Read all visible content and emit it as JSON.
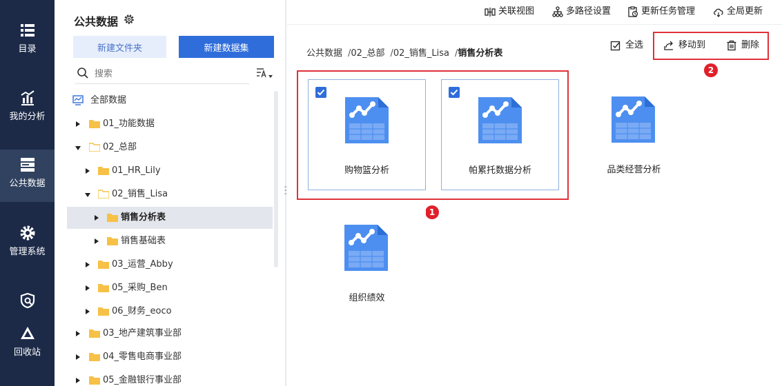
{
  "nav": {
    "items": [
      {
        "label": "目录",
        "icon": "list-icon"
      },
      {
        "label": "我的分析",
        "icon": "chart-icon"
      },
      {
        "label": "公共数据",
        "icon": "database-icon",
        "active": true
      },
      {
        "label": "管理系统",
        "icon": "gear-icon"
      },
      {
        "label": "",
        "icon": "shield-icon"
      },
      {
        "label": "回收站",
        "icon": "recycle-icon"
      }
    ]
  },
  "tree_panel": {
    "title": "公共数据",
    "new_folder_label": "新建文件夹",
    "new_dataset_label": "新建数据集",
    "search_placeholder": "搜索",
    "rows": [
      {
        "label": "全部数据"
      },
      {
        "label": "01_功能数据"
      },
      {
        "label": "02_总部"
      },
      {
        "label": "01_HR_Lily"
      },
      {
        "label": "02_销售_Lisa"
      },
      {
        "label": "销售分析表"
      },
      {
        "label": "销售基础表"
      },
      {
        "label": "03_运营_Abby"
      },
      {
        "label": "05_采购_Ben"
      },
      {
        "label": "06_财务_eoco"
      },
      {
        "label": "03_地产建筑事业部"
      },
      {
        "label": "04_零售电商事业部"
      },
      {
        "label": "05_金融银行事业部"
      }
    ]
  },
  "toolbar": {
    "related_view": "关联视图",
    "multi_path": "多路径设置",
    "update_tasks": "更新任务管理",
    "global_update": "全局更新"
  },
  "breadcrumb": {
    "items": [
      "公共数据",
      "02_总部",
      "02_销售_Lisa"
    ],
    "current": "销售分析表",
    "sep": "/"
  },
  "actions": {
    "select_all": "全选",
    "move_to": "移动到",
    "delete": "删除"
  },
  "badges": {
    "one": "1",
    "two": "2"
  },
  "cards": [
    {
      "name": "购物篮分析",
      "checked": true
    },
    {
      "name": "帕累托数据分析",
      "checked": true
    },
    {
      "name": "品类经营分析",
      "checked": false
    },
    {
      "name": "组织绩效",
      "checked": false
    }
  ],
  "colors": {
    "nav_bg": "#1c2a48",
    "accent": "#2f6ddb",
    "highlight_red": "#e0303a"
  }
}
